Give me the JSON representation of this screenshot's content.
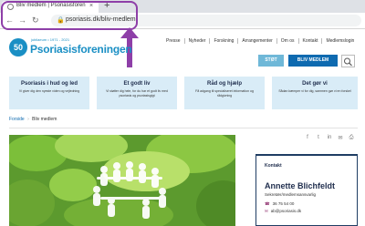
{
  "browser": {
    "tab_title": "Bliv medlem | Psoriasisforenin·",
    "tab_close": "×",
    "new_tab": "+",
    "url": "psoriasis.dk/bliv-medlem"
  },
  "annotation": {
    "color": "#8e3fa8"
  },
  "logo": {
    "number": "50",
    "tagline": "jubilaeum • 1971 - 2021",
    "name": "Psoriasisforeningen",
    "color": "#1a8fc4"
  },
  "topnav": [
    "Presse",
    "Nyheder",
    "Forskning",
    "Arrangementer",
    "Om os",
    "Kontakt",
    "Medlemslogin"
  ],
  "actions": {
    "support_label": "STØT",
    "member_label": "BLIV MEDLEM",
    "search_icon": "search-icon"
  },
  "tiles": [
    {
      "title": "Psoriasis i hud og led",
      "desc": "Vi giver dig den nyeste viden og vejledning"
    },
    {
      "title": "Et godt liv",
      "desc": "Vi støtter dig hele, for du har et godt liv med psoriasis og psoriasisgigt"
    },
    {
      "title": "Råd og hjælp",
      "desc": "Få adgang til specialiseret information og rådgivning"
    },
    {
      "title": "Det gør vi",
      "desc": "Sådan kæmper vi for dig, sammen gør vi en forskel"
    }
  ],
  "breadcrumb": {
    "home": "Forside",
    "separator": "›",
    "current": "Bliv medlem"
  },
  "share": [
    "f",
    "t",
    "in",
    "✉",
    "⎙"
  ],
  "contact": {
    "label": "Kontakt",
    "name": "Annette Blichfeldt",
    "role": "Sekretær/medlemsansvarlig",
    "phone": "36 75 54 00",
    "email": "ab@psoriasis.dk"
  },
  "colors": {
    "brand_blue": "#0e6ab0",
    "tile_bg": "#d9ecf7",
    "support_button": "#6fb8d8",
    "accent_icon": "#8c2a6a"
  }
}
